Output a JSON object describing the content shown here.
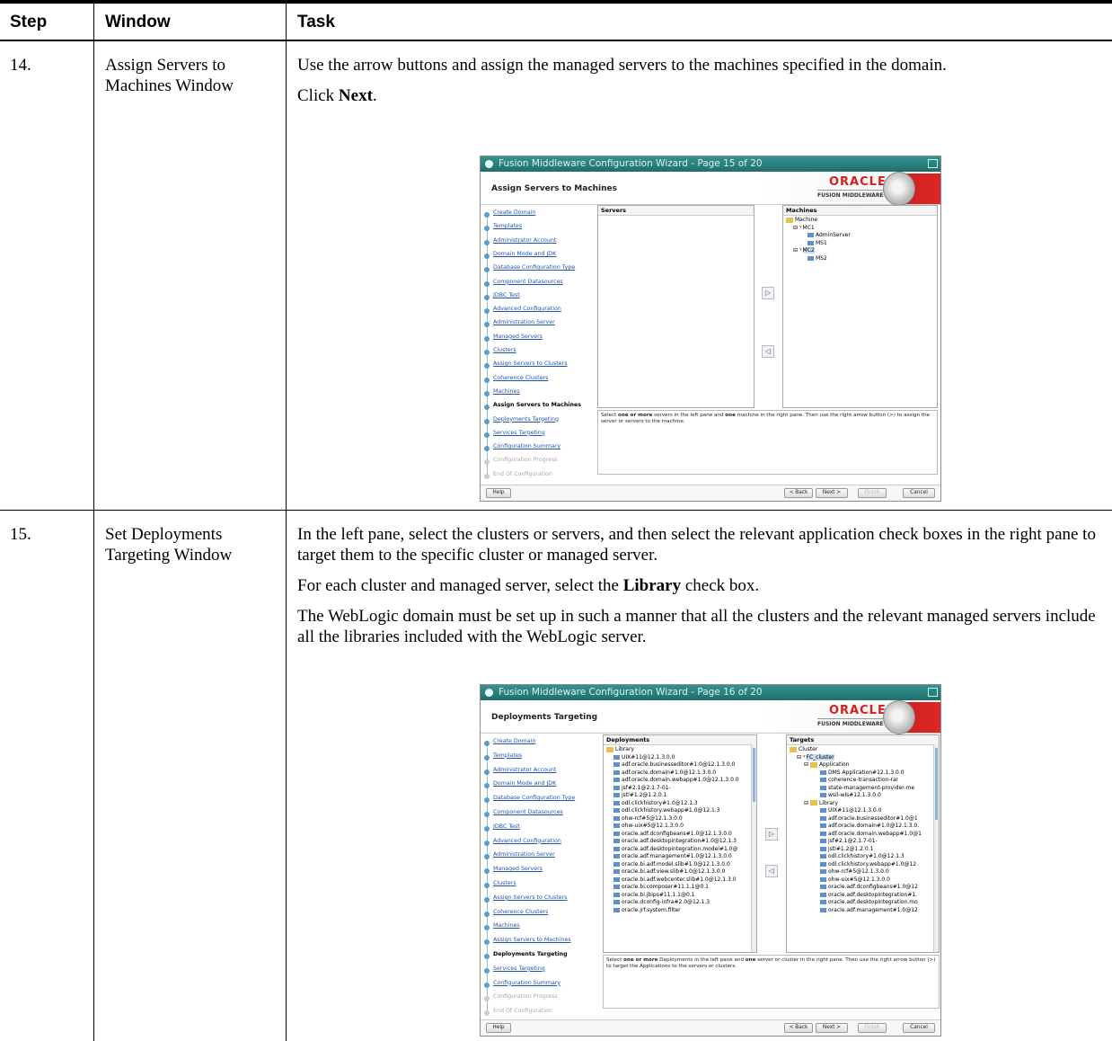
{
  "table": {
    "headers": {
      "step": "Step",
      "window": "Window",
      "task": "Task"
    },
    "rows": [
      {
        "step": "14.",
        "window": "Assign Servers to Machines Window",
        "task": {
          "p1": "Use the arrow buttons and assign the managed servers to the machines specified in the domain.",
          "p2_pre": "Click ",
          "p2_bold": "Next",
          "p2_post": "."
        }
      },
      {
        "step": "15.",
        "window": "Set Deployments Targeting Window",
        "task": {
          "p1": "In the left pane, select the clusters or servers, and then select the relevant application check boxes in the right pane to target them to the specific cluster or managed server.",
          "p2_pre": "For each cluster and managed server, select the ",
          "p2_bold": "Library",
          "p2_post": " check box.",
          "p3": "The WebLogic domain must be set up in such a manner that all the clusters and the relevant managed servers include all the libraries included with the WebLogic server."
        }
      }
    ]
  },
  "screenshot1": {
    "title": "Fusion Middleware Configuration Wizard - Page 15 of 20",
    "page_title": "Assign Servers to Machines",
    "brand": {
      "oracle": "ORACLE",
      "sub": "FUSION MIDDLEWARE"
    },
    "nav": [
      "Create Domain",
      "Templates",
      "Administrator Account",
      "Domain Mode and JDK",
      "Database Configuration Type",
      "Component Datasources",
      "JDBC Test",
      "Advanced Configuration",
      "Administration Server",
      "Managed Servers",
      "Clusters",
      "Assign Servers to Clusters",
      "Coherence Clusters",
      "Machines",
      "Assign Servers to Machines",
      "Deployments Targeting",
      "Services Targeting",
      "Configuration Summary",
      "Configuration Progress",
      "End Of Configuration"
    ],
    "current_nav": 14,
    "disabled_nav": [
      18,
      19
    ],
    "left_pane_header": "Servers",
    "right_pane_header": "Machines",
    "tree": {
      "root": "Machine",
      "mc1": "MC1",
      "admin": "AdminServer",
      "ms1": "MS1",
      "mc2": "MC2",
      "ms2": "MS2"
    },
    "hint_pre": "Select ",
    "hint_b1": "one or more",
    "hint_mid": " servers in the left pane and ",
    "hint_b2": "one",
    "hint_post": " machine in the right pane. Then use the right arrow button (>) to assign the server or servers to the machine.",
    "buttons": {
      "help": "Help",
      "back": "< Back",
      "next": "Next >",
      "finish": "Finish",
      "cancel": "Cancel"
    }
  },
  "screenshot2": {
    "title": "Fusion Middleware Configuration Wizard - Page 16 of 20",
    "page_title": "Deployments Targeting",
    "brand": {
      "oracle": "ORACLE",
      "sub": "FUSION MIDDLEWARE"
    },
    "nav": [
      "Create Domain",
      "Templates",
      "Administrator Account",
      "Domain Mode and JDK",
      "Database Configuration Type",
      "Component Datasources",
      "JDBC Test",
      "Advanced Configuration",
      "Administration Server",
      "Managed Servers",
      "Clusters",
      "Assign Servers to Clusters",
      "Coherence Clusters",
      "Machines",
      "Assign Servers to Machines",
      "Deployments Targeting",
      "Services Targeting",
      "Configuration Summary",
      "Configuration Progress",
      "End Of Configuration"
    ],
    "current_nav": 15,
    "disabled_nav": [
      18,
      19
    ],
    "left_pane_header": "Deployments",
    "left_root": "Library",
    "left_items": [
      "UIX#11@12.1.3.0.0",
      "adf.oracle.businesseditor#1.0@12.1.3.0.0",
      "adf.oracle.domain#1.0@12.1.3.0.0",
      "adf.oracle.domain.webapp#1.0@12.1.3.0.0",
      "jsf#2.1@2.1.7-01-",
      "jstl#1.2@1.2.0.1",
      "odl.clickhistory#1.0@12.1.3",
      "odl.clickhistory.webapp#1.0@12.1.3",
      "ohw-rcf#5@12.1.3.0.0",
      "ohw-uix#5@12.1.3.0.0",
      "oracle.adf.dconfigbeans#1.0@12.1.3.0.0",
      "oracle.adf.desktopintegration#1.0@12.1.3",
      "oracle.adf.desktopintegration.model#1.0@",
      "oracle.adf.management#1.0@12.1.3.0.0",
      "oracle.bi.adf.model.slib#1.0@12.1.3.0.0",
      "oracle.bi.adf.view.slib#1.0@12.1.3.0.0",
      "oracle.bi.adf.webcenter.slib#1.0@12.1.3.0",
      "oracle.bi.composer#11.1.1@0.1",
      "oracle.bi.jbips#11.1.1@0.1",
      "oracle.dconfig-infra#2.0@12.1.3",
      "oracle.jrf.system.filter"
    ],
    "right_pane_header": "Targets",
    "right_root": "Cluster",
    "right_cluster": "FC_cluster",
    "right_app": "Application",
    "right_app_items": [
      "DMS Application#12.1.3.0.0",
      "coherence-transaction-rar",
      "state-management-provider-me",
      "wsil-wls#12.1.3.0.0"
    ],
    "right_lib": "Library",
    "right_lib_items": [
      "UIX#11@12.1.3.0.0",
      "adf.oracle.businesseditor#1.0@1",
      "adf.oracle.domain#1.0@12.1.3.0.",
      "adf.oracle.domain.webapp#1.0@1",
      "jsf#2.1@2.1.7-01-",
      "jstl#1.2@1.2.0.1",
      "odl.clickhistory#1.0@12.1.3",
      "odl.clickhistory.webapp#1.0@12",
      "ohw-rcf#5@12.1.3.0.0",
      "ohw-uix#5@12.1.3.0.0",
      "oracle.adf.dconfigbeans#1.0@12",
      "oracle.adf.desktopintegration#1.",
      "oracle.adf.desktopintegration.mo",
      "oracle.adf.management#1.0@12"
    ],
    "hint_pre": "Select ",
    "hint_b1": "one or more",
    "hint_mid": " Deployments in the left pane and ",
    "hint_b2": "one",
    "hint_post": " server or cluster in the right pane. Then use the right arrow button (>) to target the Applications to the servers or clusters.",
    "buttons": {
      "help": "Help",
      "back": "< Back",
      "next": "Next >",
      "finish": "Finish",
      "cancel": "Cancel"
    }
  }
}
